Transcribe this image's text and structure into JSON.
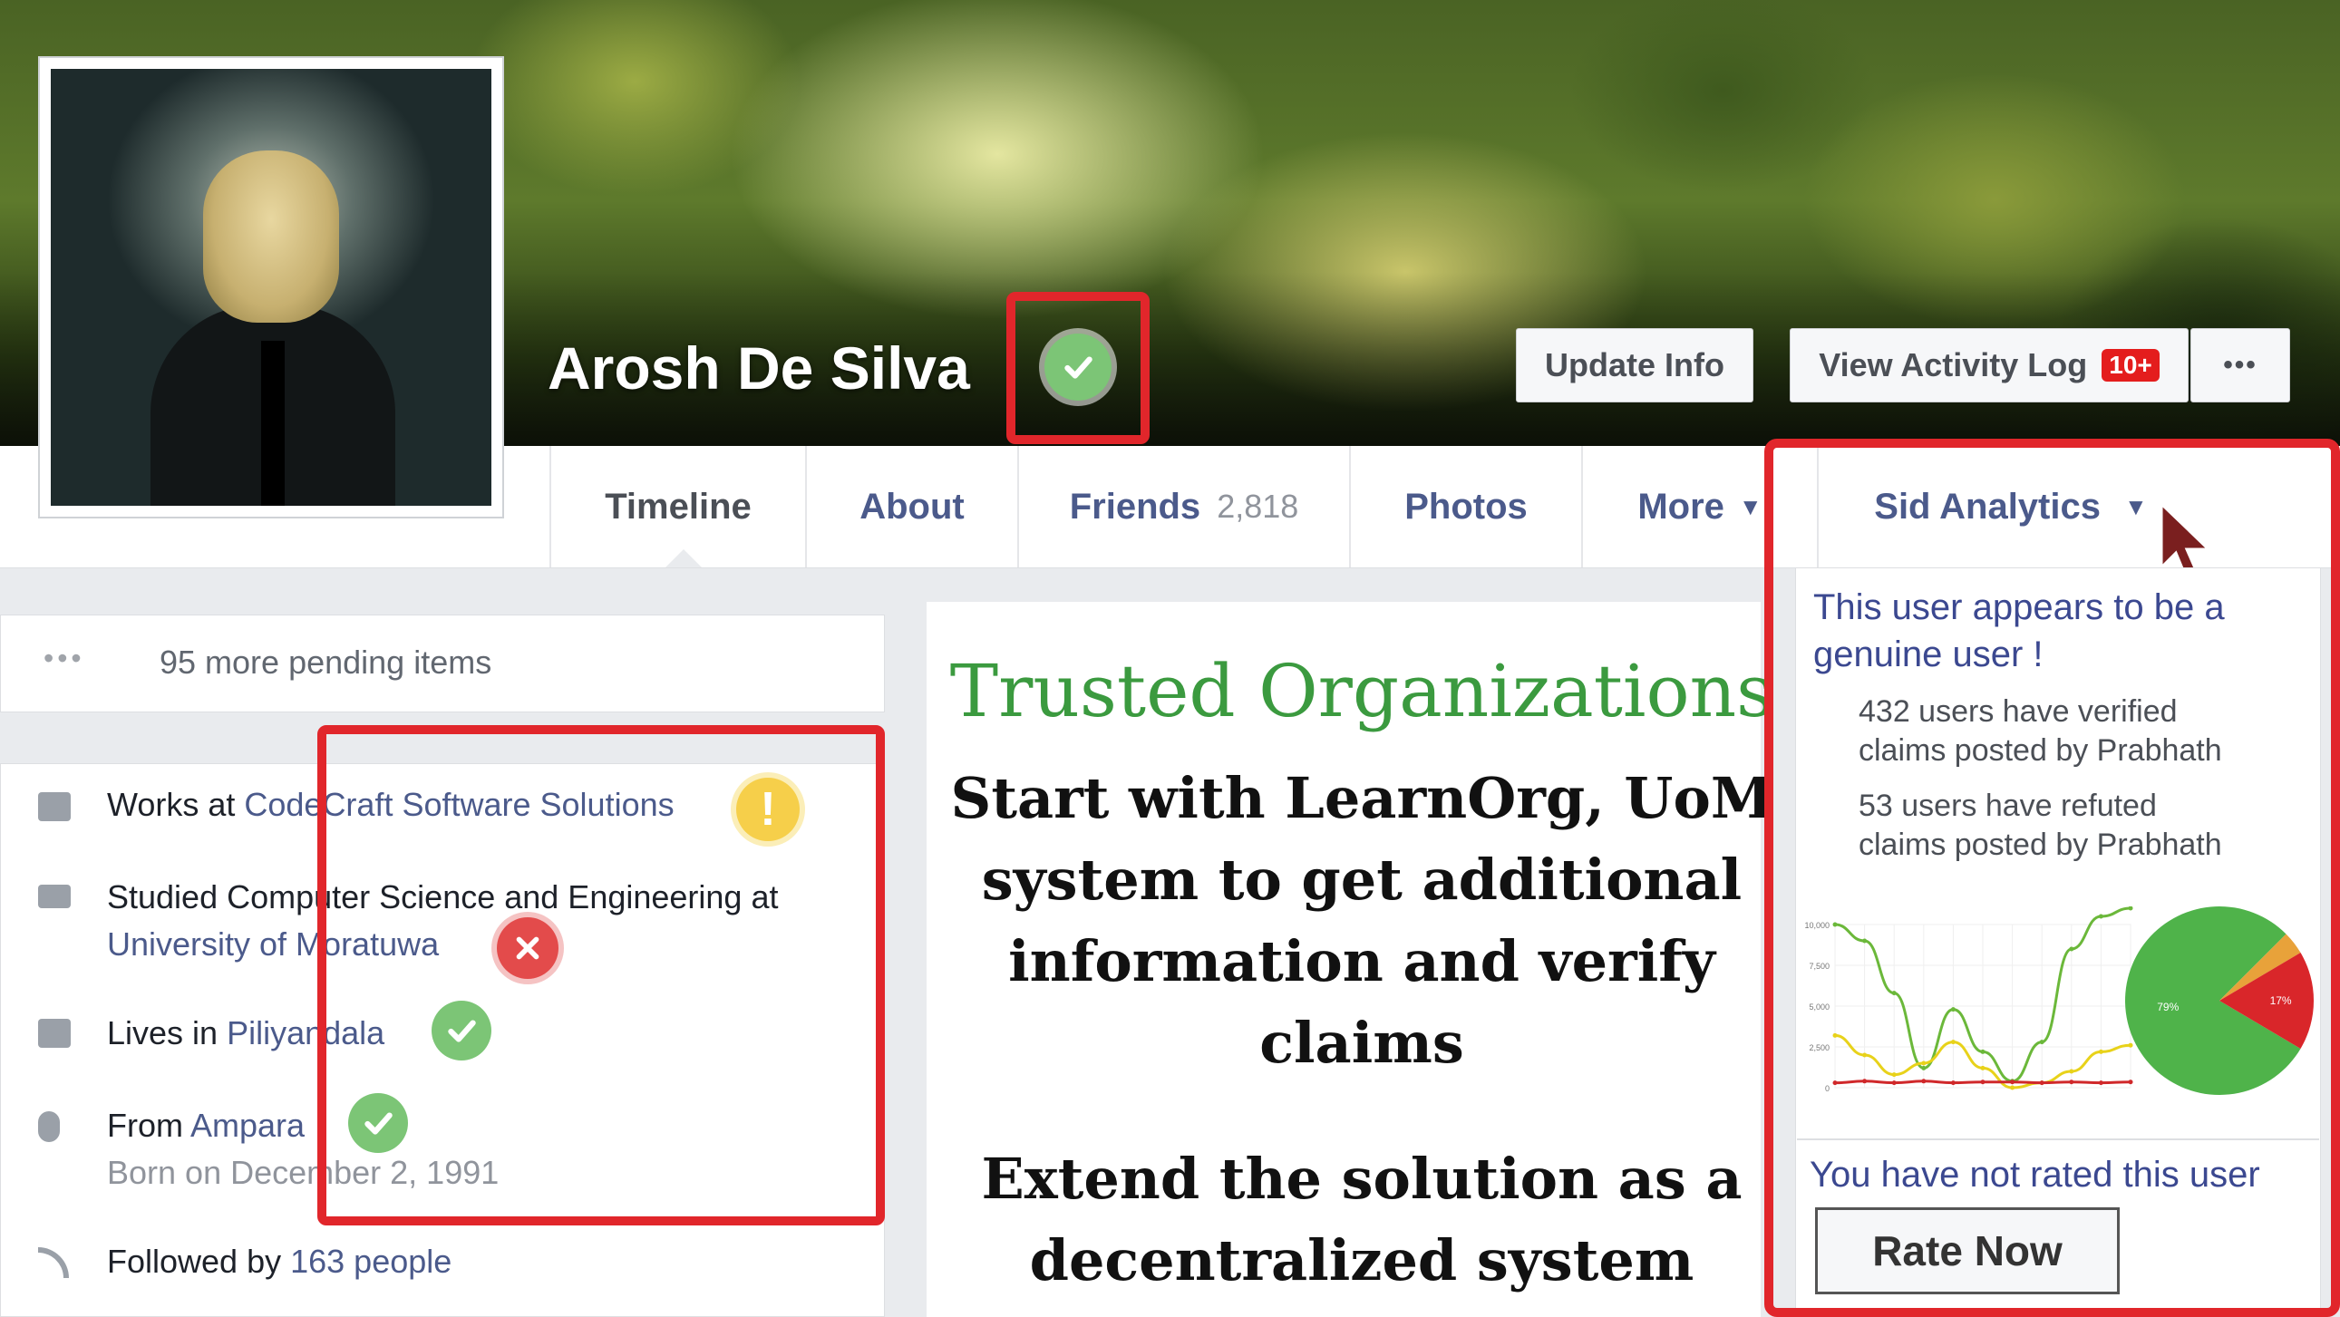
{
  "profile": {
    "name": "Arosh De Silva",
    "verified_icon": "check-circle-icon"
  },
  "cover": {
    "update_info": "Update Info",
    "view_activity_log": "View Activity Log",
    "activity_badge": "10+",
    "more_icon": "•••"
  },
  "tabs": [
    {
      "label": "Timeline"
    },
    {
      "label": "About"
    },
    {
      "label": "Friends",
      "count": "2,818"
    },
    {
      "label": "Photos"
    },
    {
      "label": "More"
    },
    {
      "label": "Sid Analytics"
    }
  ],
  "pending": {
    "dots": "•••",
    "text": "95 more pending items"
  },
  "intro": {
    "works_prefix": "Works at ",
    "works_org": "CodeCraft Software Solutions",
    "studied_prefix": "Studied Computer Science and Engineering at",
    "studied_org": "University of Moratuwa",
    "lives_prefix": "Lives in ",
    "lives_place": "Piliyandala",
    "from_prefix": "From ",
    "from_place": "Ampara",
    "born": "Born on December 2, 1991",
    "followed_prefix": "Followed by ",
    "followed_count": "163 people"
  },
  "middle": {
    "heading": "Trusted Organizations",
    "lines1": [
      "Start with LearnOrg, UoM",
      "system to get additional",
      "information and verify",
      "claims"
    ],
    "lines2": [
      "Extend the solution as a",
      "decentralized system"
    ]
  },
  "analytics": {
    "genuine_line1": "This user appears to be a",
    "genuine_line2": "genuine user !",
    "verified_line1": "432 users have verified",
    "verified_line2": "claims posted by Prabhath",
    "refuted_line1": "53 users have refuted",
    "refuted_line2": "claims posted by Prabhath",
    "not_rated": "You have not rated this user",
    "rate_button": "Rate Now"
  },
  "colors": {
    "accent_red": "#e1262b",
    "verified_green": "#7cc576",
    "warning_yellow": "#f6cf4a",
    "error_red": "#e34b4b",
    "link_blue": "#4b5a8b",
    "trusted_green": "#3b9a3f"
  },
  "chart_data": [
    {
      "type": "line",
      "x": [
        0,
        1,
        2,
        3,
        4,
        5,
        6,
        7,
        8,
        9,
        10
      ],
      "yticks": [
        "0",
        "2,500",
        "5,000",
        "7,500",
        "10,000"
      ],
      "ylim": [
        0,
        10000
      ],
      "series": [
        {
          "color": "#6bb83a",
          "values": [
            10000,
            9000,
            5800,
            1200,
            4800,
            2200,
            400,
            2800,
            8500,
            10500,
            11000
          ]
        },
        {
          "color": "#e8d21a",
          "values": [
            3200,
            2000,
            800,
            1500,
            2800,
            1200,
            0,
            300,
            1000,
            2200,
            2600
          ]
        },
        {
          "color": "#d0282a",
          "values": [
            300,
            400,
            300,
            400,
            300,
            350,
            350,
            300,
            350,
            300,
            350
          ]
        }
      ]
    },
    {
      "type": "pie",
      "slices": [
        {
          "label": "79%",
          "value": 79,
          "color": "#4fb34a"
        },
        {
          "label": "17%",
          "value": 17,
          "color": "#d9262a"
        },
        {
          "value": 4,
          "color": "#e8a23a"
        }
      ]
    }
  ]
}
